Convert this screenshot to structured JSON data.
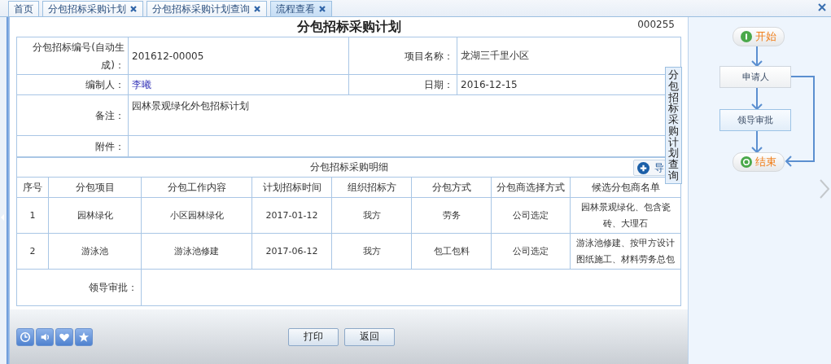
{
  "tabs": [
    {
      "label": "首页",
      "closable": false,
      "selected": false
    },
    {
      "label": "分包招标采购计划",
      "closable": true,
      "selected": false
    },
    {
      "label": "分包招标采购计划查询",
      "closable": true,
      "selected": false
    },
    {
      "label": "流程查看",
      "closable": true,
      "selected": true
    }
  ],
  "form": {
    "title": "分包招标采购计划",
    "number": "000255",
    "fields": [
      {
        "label": "分包招标编号(自动生成)：",
        "value": "201612-00005"
      },
      {
        "label": "项目名称：",
        "value": "龙湖三千里小区"
      },
      {
        "label": "编制人：",
        "value": "李曦",
        "kind": "link"
      },
      {
        "label": "日期：",
        "value": "2016-12-15"
      },
      {
        "label": "备注：",
        "value": "园林景观绿化外包招标计划",
        "kind": "wide"
      },
      {
        "label": "附件：",
        "kind": "wide"
      }
    ],
    "details": {
      "title": "分包招标采购明细",
      "add_button": "导",
      "columns": [
        "序号",
        "分包项目",
        "分包工作内容",
        "计划招标时间",
        "组织招标方",
        "分包方式",
        "分包商选择方式",
        "候选分包商名单"
      ],
      "rows": [
        [
          "1",
          "园林绿化",
          "小区园林绿化",
          "2017-01-12",
          "我方",
          "劳务",
          "公司选定",
          "园林景观绿化、包含瓷砖、大理石"
        ],
        [
          "2",
          "游泳池",
          "游泳池修建",
          "2017-06-12",
          "我方",
          "包工包料",
          "公司选定",
          "游泳池修建、按甲方设计图纸施工、材料劳务总包"
        ]
      ]
    },
    "approval_label": "领导审批：",
    "side_tab": "分包招标采购计划查询"
  },
  "toolbar_icons": [
    {
      "kind": "clock"
    },
    {
      "kind": "speaker"
    },
    {
      "kind": "heart"
    },
    {
      "kind": "star"
    }
  ],
  "buttons": [
    "打印",
    "返回"
  ],
  "flow": {
    "nodes": [
      {
        "label": "开始",
        "kind": "start"
      },
      {
        "label": "申请人",
        "kind": "step"
      },
      {
        "label": "领导审批",
        "kind": "step"
      },
      {
        "label": "结束",
        "kind": "end"
      }
    ]
  }
}
